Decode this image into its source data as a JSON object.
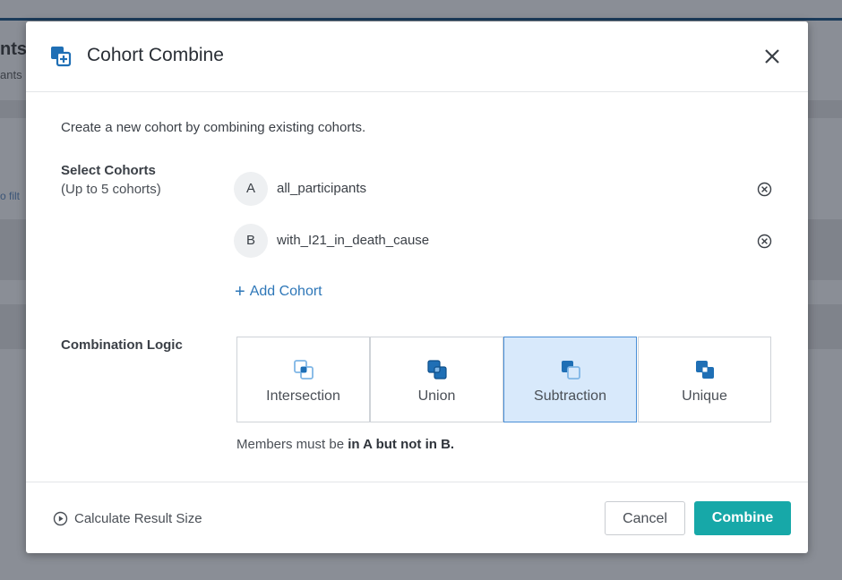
{
  "background": {
    "title_fragment": "nts",
    "subtitle_fragment": "ants",
    "filter_fragment": "o filt"
  },
  "modal": {
    "title": "Cohort Combine",
    "intro": "Create a new cohort by combining existing cohorts.",
    "select_label": "Select Cohorts",
    "select_sublabel": "(Up to 5 cohorts)",
    "cohorts": [
      {
        "letter": "A",
        "name": "all_participants"
      },
      {
        "letter": "B",
        "name": "with_I21_in_death_cause"
      }
    ],
    "add_cohort": "Add Cohort",
    "logic_label": "Combination Logic",
    "logic_options": [
      {
        "label": "Intersection",
        "icon": "intersection-icon"
      },
      {
        "label": "Union",
        "icon": "union-icon"
      },
      {
        "label": "Subtraction",
        "icon": "subtraction-icon"
      },
      {
        "label": "Unique",
        "icon": "unique-icon"
      }
    ],
    "selected_logic": "Subtraction",
    "description_prefix": "Members must be ",
    "description_bold": "in A but not in B.",
    "calculate": "Calculate Result Size",
    "cancel": "Cancel",
    "combine": "Combine"
  },
  "colors": {
    "accent": "#2e77b8",
    "combine_button": "#17a8a8",
    "selected_bg": "#d8e9fb",
    "selected_border": "#4a8fd6",
    "icon_blue": "#1f6fb5"
  }
}
